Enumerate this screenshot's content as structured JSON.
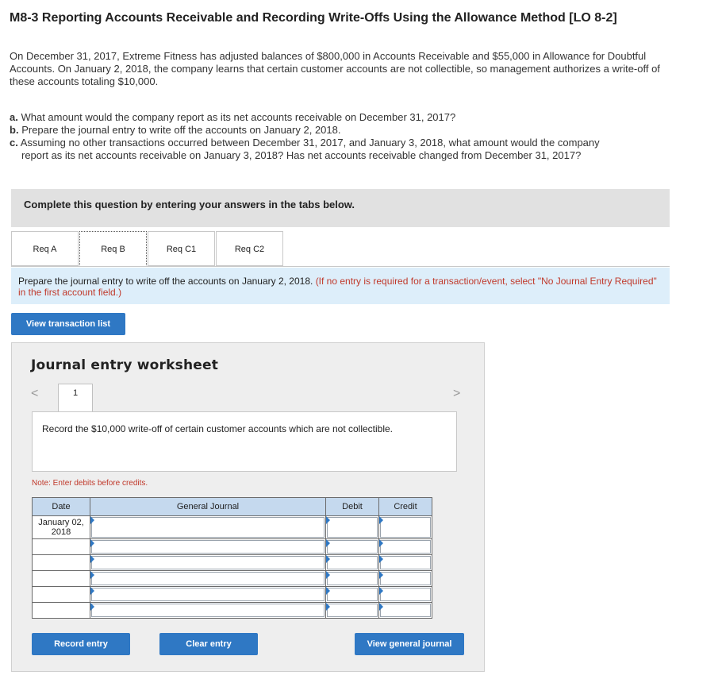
{
  "header": {
    "title": "M8-3 Reporting Accounts Receivable and Recording Write-Offs Using the Allowance Method [LO 8-2]"
  },
  "intro": "On December 31, 2017, Extreme Fitness has adjusted balances of $800,000 in Accounts Receivable and $55,000 in Allowance for Doubtful Accounts. On January 2, 2018, the company learns that certain customer accounts are not collectible, so management authorizes a write-off of these accounts totaling $10,000.",
  "questions": {
    "a": {
      "label": "a.",
      "text": "What amount would the company report as its net accounts receivable on December 31, 2017?"
    },
    "b": {
      "label": "b.",
      "text": "Prepare the journal entry to write off the accounts on January 2, 2018."
    },
    "c": {
      "label": "c.",
      "text": "Assuming no other transactions occurred between December 31, 2017, and January 3, 2018, what amount would the company",
      "text2": "report as its net accounts receivable on January 3, 2018? Has net accounts receivable changed from December 31, 2017?"
    }
  },
  "banner": "Complete this question by entering your answers in the tabs below.",
  "tabs": [
    "Req A",
    "Req B",
    "Req C1",
    "Req C2"
  ],
  "active_tab": "Req B",
  "instruction": {
    "text": "Prepare the journal entry to write off the accounts on January 2, 2018.",
    "hint": "(If no entry is required for a transaction/event, select \"No Journal Entry Required\" in the first account field.)"
  },
  "buttons": {
    "view_transactions": "View transaction list",
    "record_entry": "Record entry",
    "clear_entry": "Clear entry",
    "view_journal": "View general journal"
  },
  "worksheet": {
    "title": "Journal entry worksheet",
    "page": "1",
    "prev_icon": "<",
    "next_icon": ">",
    "description": "Record the $10,000 write-off of certain customer accounts which are not collectible.",
    "note": "Note: Enter debits before credits.",
    "columns": [
      "Date",
      "General Journal",
      "Debit",
      "Credit"
    ],
    "date_line1": "January 02,",
    "date_line2": "2018"
  },
  "colors": {
    "button": "#2f78c4",
    "header_row": "#c5d9ee",
    "instruction_bg": "#ddeefa",
    "hint": "#c0392b"
  }
}
